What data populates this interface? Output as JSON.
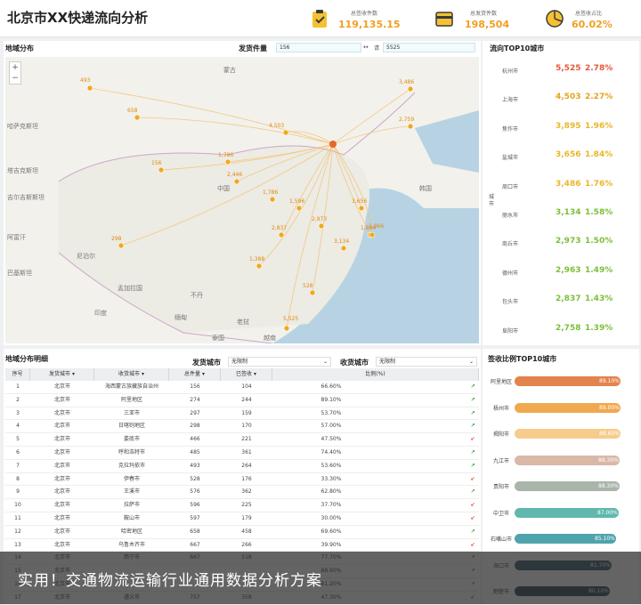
{
  "header": {
    "title": "北京市XX快递流向分析"
  },
  "kpis": [
    {
      "label": "总签收件数",
      "value": "119,135.15"
    },
    {
      "label": "总发货件数",
      "value": "198,504"
    },
    {
      "label": "总签收占比",
      "value": "60.02%"
    }
  ],
  "map_panel": {
    "title": "地域分布",
    "filter_label": "发货件量",
    "from": "156",
    "to_sep": "请",
    "to": "5525"
  },
  "map": {
    "zoom_in": "+",
    "zoom_out": "−",
    "labels": [
      "蒙古",
      "中国",
      "印度",
      "缅甸",
      "泰国",
      "越南",
      "老挝",
      "孟加拉国",
      "尼泊尔",
      "阿富汗",
      "巴基斯坦",
      "塔吉克斯坦",
      "哈萨克斯坦",
      "吉尔吉斯斯坦",
      "不丹",
      "韩国"
    ],
    "points": [
      {
        "t": "493"
      },
      {
        "t": "658"
      },
      {
        "t": "156"
      },
      {
        "t": "298"
      },
      {
        "t": "1,786"
      },
      {
        "t": "2,446"
      },
      {
        "t": "2,837"
      },
      {
        "t": "1,388"
      },
      {
        "t": "528"
      },
      {
        "t": "1,884"
      },
      {
        "t": "3,656"
      },
      {
        "t": "3,486"
      },
      {
        "t": "2,759"
      },
      {
        "t": "1,966"
      },
      {
        "t": "4,503"
      },
      {
        "t": "5,525"
      },
      {
        "t": "1,596"
      },
      {
        "t": "2,973"
      },
      {
        "t": "1,786"
      },
      {
        "t": "3,134"
      }
    ]
  },
  "top10": {
    "title": "流向TOP10城市",
    "side_label": "城市",
    "rows": [
      {
        "city": "杭州市",
        "num": "5,525",
        "pct": "2.78%",
        "color": "#e35a3a"
      },
      {
        "city": "上海市",
        "num": "4,503",
        "pct": "2.27%",
        "color": "#e9a21b"
      },
      {
        "city": "焦作市",
        "num": "3,895",
        "pct": "1.96%",
        "color": "#e9b62a"
      },
      {
        "city": "盐城市",
        "num": "3,656",
        "pct": "1.84%",
        "color": "#e9b62a"
      },
      {
        "city": "周口市",
        "num": "3,486",
        "pct": "1.76%",
        "color": "#e9b62a"
      },
      {
        "city": "丽水市",
        "num": "3,134",
        "pct": "1.58%",
        "color": "#7bbf3a"
      },
      {
        "city": "商丘市",
        "num": "2,973",
        "pct": "1.50%",
        "color": "#7bbf3a"
      },
      {
        "city": "德州市",
        "num": "2,963",
        "pct": "1.49%",
        "color": "#7bbf3a"
      },
      {
        "city": "包头市",
        "num": "2,837",
        "pct": "1.43%",
        "color": "#7bbf3a"
      },
      {
        "city": "阜阳市",
        "num": "2,758",
        "pct": "1.39%",
        "color": "#7bbf3a"
      }
    ]
  },
  "detail": {
    "title": "地域分布明细",
    "send_label": "发货城市",
    "send_value": "无限制",
    "recv_label": "收货城市",
    "recv_value": "无限制",
    "headers": [
      "序号",
      "发货城市",
      "收货城市",
      "总件量",
      "已签收",
      "比例(%)"
    ],
    "rows": [
      [
        "1",
        "北京市",
        "海西蒙古族藏族自治州",
        "156",
        "104",
        "66.60%",
        "up"
      ],
      [
        "2",
        "北京市",
        "阿里地区",
        "274",
        "244",
        "89.10%",
        "up"
      ],
      [
        "3",
        "北京市",
        "三亚市",
        "297",
        "159",
        "53.70%",
        "up"
      ],
      [
        "4",
        "北京市",
        "日喀则地区",
        "298",
        "170",
        "57.00%",
        "up"
      ],
      [
        "5",
        "北京市",
        "娄底市",
        "466",
        "221",
        "47.50%",
        "down"
      ],
      [
        "6",
        "北京市",
        "呼和浩特市",
        "485",
        "361",
        "74.40%",
        "up"
      ],
      [
        "7",
        "北京市",
        "克拉玛依市",
        "493",
        "264",
        "53.60%",
        "up"
      ],
      [
        "8",
        "北京市",
        "伊春市",
        "528",
        "176",
        "33.30%",
        "down"
      ],
      [
        "9",
        "北京市",
        "王溪市",
        "576",
        "362",
        "62.80%",
        "up"
      ],
      [
        "10",
        "北京市",
        "拉萨市",
        "596",
        "225",
        "37.70%",
        "down"
      ],
      [
        "11",
        "北京市",
        "鞍山市",
        "597",
        "179",
        "30.00%",
        "down"
      ],
      [
        "12",
        "北京市",
        "哈密地区",
        "658",
        "458",
        "69.60%",
        "up"
      ],
      [
        "13",
        "北京市",
        "乌鲁木齐市",
        "667",
        "266",
        "39.90%",
        "down"
      ],
      [
        "14",
        "北京市",
        "西宁市",
        "667",
        "518",
        "77.70%",
        "up"
      ],
      [
        "15",
        "北京市",
        "",
        "",
        "",
        "88.60%",
        "up"
      ],
      [
        "16",
        "北京市",
        "",
        "",
        "",
        "81.20%",
        "up"
      ],
      [
        "17",
        "北京市",
        "遵义市",
        "757",
        "358",
        "47.30%",
        "down"
      ]
    ]
  },
  "signrate": {
    "title": "签收比例TOP10城市",
    "rows": [
      {
        "city": "阿里地区",
        "pct": "89.10%",
        "value": 89.1,
        "color": "#e3834d"
      },
      {
        "city": "梧州市",
        "pct": "89.00%",
        "value": 89.0,
        "color": "#f0a94e"
      },
      {
        "city": "揭阳市",
        "pct": "88.60%",
        "value": 88.6,
        "color": "#f6cc8c"
      },
      {
        "city": "九江市",
        "pct": "88.30%",
        "value": 88.3,
        "color": "#d9b8a8"
      },
      {
        "city": "贵阳市",
        "pct": "88.30%",
        "value": 88.3,
        "color": "#a9b4aa"
      },
      {
        "city": "中卫市",
        "pct": "87.00%",
        "value": 87.0,
        "color": "#5fb8ad"
      },
      {
        "city": "石嘴山市",
        "pct": "85.10%",
        "value": 85.1,
        "color": "#4fa3ad"
      },
      {
        "city": "海口市",
        "pct": "81.70%",
        "value": 81.7,
        "color": "#3a5c6a"
      },
      {
        "city": "鹤壁市",
        "pct": "80.10%",
        "value": 80.1,
        "color": "#2f4a58"
      }
    ]
  },
  "banner": {
    "text": "实用！交通物流运输行业通用数据分析方案"
  }
}
